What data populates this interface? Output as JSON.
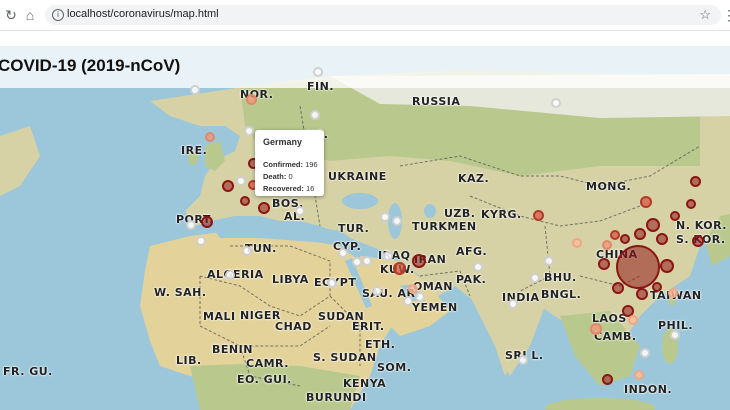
{
  "browser": {
    "url": "localhost/coronavirus/map.html",
    "back_icon": "back-arrow-icon",
    "reload_icon": "reload-icon",
    "home_icon": "home-icon",
    "info_icon": "info-icon",
    "bookmark_icon": "star-icon"
  },
  "page": {
    "title": "COVID-19 (2019-nCoV)"
  },
  "map": {
    "labels": [
      {
        "id": "russia",
        "text": "RUSSIA"
      },
      {
        "id": "kaz",
        "text": "KAZ."
      },
      {
        "id": "mong",
        "text": "MONG."
      },
      {
        "id": "china",
        "text": "CHINA"
      },
      {
        "id": "india",
        "text": "INDIA"
      },
      {
        "id": "pak",
        "text": "PAK."
      },
      {
        "id": "iran",
        "text": "IRAN"
      },
      {
        "id": "iraq",
        "text": "IRAQ"
      },
      {
        "id": "sau",
        "text": "SAU. AR."
      },
      {
        "id": "oman",
        "text": "OMAN"
      },
      {
        "id": "yemen",
        "text": "YEMEN"
      },
      {
        "id": "egypt",
        "text": "EGYPT"
      },
      {
        "id": "libya",
        "text": "LIBYA"
      },
      {
        "id": "algeria",
        "text": "ALGERIA"
      },
      {
        "id": "mali",
        "text": "MALI"
      },
      {
        "id": "niger",
        "text": "NIGER"
      },
      {
        "id": "chad",
        "text": "CHAD"
      },
      {
        "id": "sudan",
        "text": "SUDAN"
      },
      {
        "id": "ssudan",
        "text": "S. SUDAN"
      },
      {
        "id": "eth",
        "text": "ETH."
      },
      {
        "id": "som",
        "text": "SOM."
      },
      {
        "id": "kenya",
        "text": "KENYA"
      },
      {
        "id": "uzb",
        "text": "UZB."
      },
      {
        "id": "kyrg",
        "text": "KYRG."
      },
      {
        "id": "turkmen",
        "text": "TURKMEN"
      },
      {
        "id": "afg",
        "text": "AFG."
      },
      {
        "id": "ukraine",
        "text": "UKRAINE"
      },
      {
        "id": "nor",
        "text": "NOR."
      },
      {
        "id": "fin",
        "text": "FIN."
      },
      {
        "id": "ire",
        "text": "IRE."
      },
      {
        "id": "port",
        "text": "PORT."
      },
      {
        "id": "tun",
        "text": "TUN."
      },
      {
        "id": "wsah",
        "text": "W. SAH."
      },
      {
        "id": "nkor",
        "text": "N. KOR."
      },
      {
        "id": "skor",
        "text": "S. KOR."
      },
      {
        "id": "taiwan",
        "text": "TAIWAN"
      },
      {
        "id": "laos",
        "text": "LAOS"
      },
      {
        "id": "phil",
        "text": "PHIL."
      },
      {
        "id": "bhu",
        "text": "BHU."
      },
      {
        "id": "bngl",
        "text": "BNGL."
      },
      {
        "id": "srl",
        "text": "SRI L."
      },
      {
        "id": "camb",
        "text": "CAMB."
      },
      {
        "id": "indon",
        "text": "INDON."
      },
      {
        "id": "erit",
        "text": "ERIT."
      },
      {
        "id": "benin",
        "text": "BENIN"
      },
      {
        "id": "camr",
        "text": "CAMR."
      },
      {
        "id": "eogui",
        "text": "EO. GUI."
      },
      {
        "id": "burundi",
        "text": "BURUNDI"
      },
      {
        "id": "lib",
        "text": "LIB."
      },
      {
        "id": "frgu",
        "text": "FR. GU."
      },
      {
        "id": "cyp",
        "text": "CYP."
      },
      {
        "id": "kuw",
        "text": "KUW."
      },
      {
        "id": "bos",
        "text": "BOS."
      },
      {
        "id": "al",
        "text": "AL."
      },
      {
        "id": "tur",
        "text": "TUR."
      },
      {
        "id": "ne",
        "text": "NE."
      }
    ],
    "tooltip": {
      "country": "Germany",
      "confirmed_label": "Confirmed:",
      "confirmed": "196",
      "death_label": "Death:",
      "death": "0",
      "recovered_label": "Recovered:",
      "recovered": "16"
    },
    "colors": {
      "water": "#9cc6d9",
      "land": "#d9d3a6",
      "forest": "#b9c98e",
      "snow": "#eef0ea",
      "desert": "#e3d39b",
      "marker_dark": "#8b1414",
      "marker_mid": "#b23a2b",
      "marker_light": "#e0886a"
    }
  }
}
